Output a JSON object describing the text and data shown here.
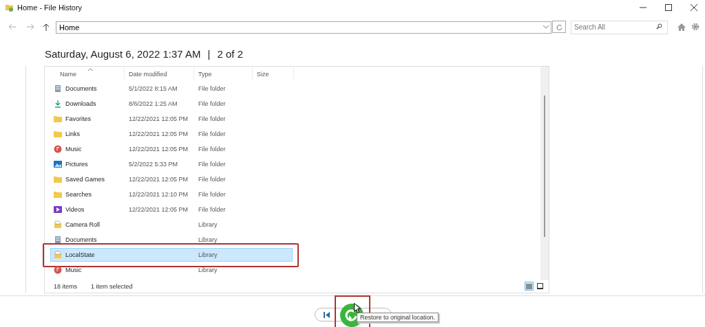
{
  "window": {
    "title": "Home - File History"
  },
  "address": {
    "value": "Home"
  },
  "search": {
    "placeholder": "Search All"
  },
  "heading": {
    "date": "Saturday, August 6, 2022 1:37 AM",
    "separator": "|",
    "position": "2 of 2"
  },
  "table": {
    "columns": [
      "Name",
      "Date modified",
      "Type",
      "Size"
    ],
    "rows": [
      {
        "kind": "documents",
        "name": "Documents",
        "date": "5/1/2022 8:15 AM",
        "type": "File folder",
        "selected": false,
        "highlighted": false
      },
      {
        "kind": "downloads",
        "name": "Downloads",
        "date": "8/6/2022 1:25 AM",
        "type": "File folder",
        "selected": false,
        "highlighted": false
      },
      {
        "kind": "folder",
        "name": "Favorites",
        "date": "12/22/2021 12:05 PM",
        "type": "File folder",
        "selected": false,
        "highlighted": false
      },
      {
        "kind": "folder",
        "name": "Links",
        "date": "12/22/2021 12:05 PM",
        "type": "File folder",
        "selected": false,
        "highlighted": false
      },
      {
        "kind": "music",
        "name": "Music",
        "date": "12/22/2021 12:05 PM",
        "type": "File folder",
        "selected": false,
        "highlighted": false
      },
      {
        "kind": "pictures",
        "name": "Pictures",
        "date": "5/2/2022 5:33 PM",
        "type": "File folder",
        "selected": false,
        "highlighted": false
      },
      {
        "kind": "folder",
        "name": "Saved Games",
        "date": "12/22/2021 12:05 PM",
        "type": "File folder",
        "selected": false,
        "highlighted": false
      },
      {
        "kind": "folder",
        "name": "Searches",
        "date": "12/22/2021 12:10 PM",
        "type": "File folder",
        "selected": false,
        "highlighted": false
      },
      {
        "kind": "videos",
        "name": "Videos",
        "date": "12/22/2021 12:05 PM",
        "type": "File folder",
        "selected": false,
        "highlighted": false
      },
      {
        "kind": "library",
        "name": "Camera Roll",
        "type": "Library",
        "selected": false,
        "highlighted": false
      },
      {
        "kind": "documents",
        "name": "Documents",
        "type": "Library",
        "selected": false,
        "highlighted": false
      },
      {
        "kind": "library",
        "name": "LocalState",
        "type": "Library",
        "selected": true,
        "highlighted": true
      },
      {
        "kind": "music",
        "name": "Music",
        "type": "Library",
        "selected": false,
        "highlighted": false
      }
    ]
  },
  "status_bar": {
    "count": "18 items",
    "selection": "1 item selected"
  },
  "view_buttons": [
    {
      "kind": "details",
      "selected": true
    },
    {
      "kind": "tiles",
      "selected": false
    }
  ],
  "restore": {
    "highlighted": true,
    "tooltip": "Restore to original location."
  }
}
